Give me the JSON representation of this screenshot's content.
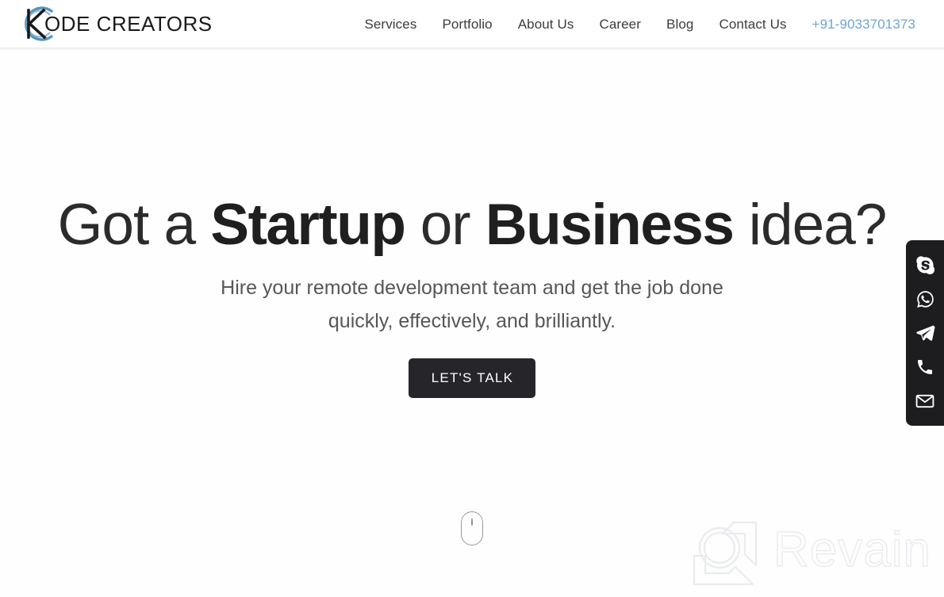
{
  "header": {
    "logo": {
      "mark_icon": "kode-creators-circle-k-icon",
      "text": "ODE CREATORS",
      "arc_color": "#5b93b8",
      "letter_color": "#1a1a1a"
    },
    "nav": [
      {
        "label": "Services",
        "name": "nav-item-services"
      },
      {
        "label": "Portfolio",
        "name": "nav-item-portfolio"
      },
      {
        "label": "About Us",
        "name": "nav-item-about-us"
      },
      {
        "label": "Career",
        "name": "nav-item-career"
      },
      {
        "label": "Blog",
        "name": "nav-item-blog"
      },
      {
        "label": "Contact Us",
        "name": "nav-item-contact-us"
      }
    ],
    "phone": {
      "label": "+91-9033701373",
      "color": "#6fa4d6"
    }
  },
  "hero": {
    "headline": {
      "part1": "Got a ",
      "bold1": "Startup",
      "part2": " or ",
      "bold2": "Business",
      "part3": " idea?"
    },
    "subhead_line1": "Hire your remote development team and get the job done",
    "subhead_line2": "quickly, effectively, and brilliantly.",
    "cta_label": "LET'S TALK",
    "cta_background": "#26262a",
    "cta_text_color": "#ffffff",
    "scroll_icon": "scroll-mouse-icon"
  },
  "social_sidebar": {
    "background": "#1d1d20",
    "items": [
      {
        "name": "skype-icon",
        "label": "Skype"
      },
      {
        "name": "whatsapp-icon",
        "label": "WhatsApp"
      },
      {
        "name": "telegram-icon",
        "label": "Telegram"
      },
      {
        "name": "phone-icon",
        "label": "Phone"
      },
      {
        "name": "email-icon",
        "label": "Email"
      }
    ]
  },
  "watermark": {
    "logo_icon": "revain-logo-icon",
    "text": "Revain",
    "color": "#e9ebed"
  }
}
